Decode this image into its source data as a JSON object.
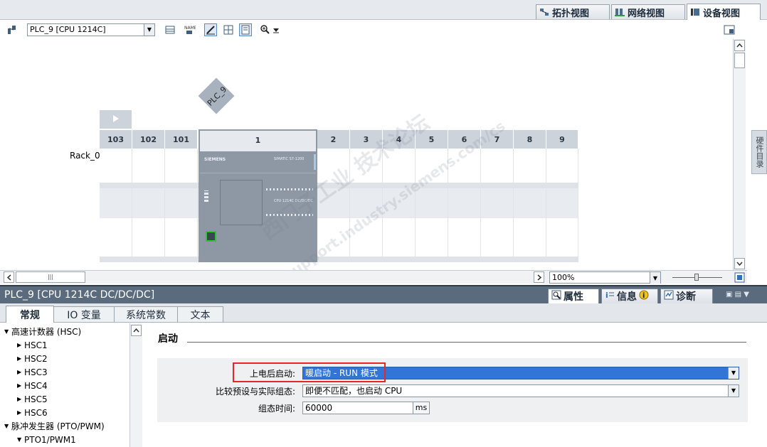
{
  "view_tabs": [
    {
      "label": "拓扑视图",
      "icon": "topology-icon"
    },
    {
      "label": "网络视图",
      "icon": "network-icon"
    },
    {
      "label": "设备视图",
      "icon": "device-icon"
    }
  ],
  "toolbar": {
    "device_select": "PLC_9 [CPU 1214C]"
  },
  "canvas": {
    "device_label": "PLC_9",
    "rack_name": "Rack_0",
    "slots": [
      "103",
      "102",
      "101",
      "1",
      "2",
      "3",
      "4",
      "5",
      "6",
      "7",
      "8",
      "9"
    ],
    "cpu_brand": "SIEMENS",
    "cpu_model": "SIMATIC S7-1200",
    "cpu_type": "CPU 1214C DC/DC/DC",
    "zoom": "100%",
    "side_tab": "硬件目录"
  },
  "watermark": {
    "line1": "西门子工业  技术论坛",
    "line2": "support.industry.siemens.com/cs"
  },
  "properties": {
    "title": "PLC_9 [CPU 1214C DC/DC/DC]",
    "tabs": [
      "属性",
      "信息",
      "诊断"
    ],
    "sub_tabs": [
      "常规",
      "IO 变量",
      "系统常数",
      "文本"
    ]
  },
  "tree": {
    "items": [
      {
        "label": "高速计数器 (HSC)",
        "level": 0
      },
      {
        "label": "HSC1",
        "level": 1
      },
      {
        "label": "HSC2",
        "level": 1
      },
      {
        "label": "HSC3",
        "level": 1
      },
      {
        "label": "HSC4",
        "level": 1
      },
      {
        "label": "HSC5",
        "level": 1
      },
      {
        "label": "HSC6",
        "level": 1
      },
      {
        "label": "脉冲发生器 (PTO/PWM)",
        "level": 0
      },
      {
        "label": "PTO1/PWM1",
        "level": 1
      }
    ]
  },
  "startup": {
    "section_title": "启动",
    "power_on_label": "上电后启动:",
    "power_on_value": "暖启动 - RUN 模式",
    "compare_label": "比较预设与实际组态:",
    "compare_value": "即便不匹配，也启动 CPU",
    "config_time_label": "组态时间:",
    "config_time_value": "60000",
    "config_time_unit": "ms"
  }
}
